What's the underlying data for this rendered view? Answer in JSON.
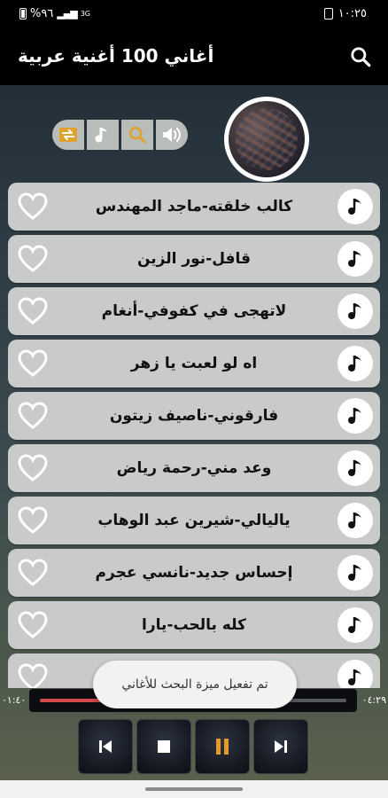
{
  "status_bar": {
    "time": "١٠:٢٥",
    "battery": "%٩٦",
    "network": "3G"
  },
  "app_bar": {
    "title": "أغاني 100 أغنية عربية",
    "search_icon": "search-icon"
  },
  "controls": [
    "repeat-icon",
    "music-note-icon",
    "search-icon",
    "volume-icon"
  ],
  "songs": [
    {
      "title": "كالب خلقته-ماجد المهندس"
    },
    {
      "title": "قافل-نور الزين"
    },
    {
      "title": "لاتهجى في كفوفي-أنغام"
    },
    {
      "title": "اه لو لعبت يا زهر"
    },
    {
      "title": "فارقوني-ناصيف زيتون"
    },
    {
      "title": "وعد مني-رحمة رياض"
    },
    {
      "title": "ياليالي-شيرين عبد الوهاب"
    },
    {
      "title": "إحساس جديد-نانسي عجرم"
    },
    {
      "title": "كله بالحب-يارا"
    },
    {
      "title": ""
    }
  ],
  "player": {
    "elapsed": "٠١:٤٠",
    "duration": "٠٤:٢٩",
    "progress": 0.37,
    "accent_color": "#d04a4a"
  },
  "toast": {
    "message": "تم تفعيل ميزة البحث للأغاني"
  },
  "player_controls": [
    "previous-icon",
    "stop-icon",
    "pause-icon",
    "next-icon"
  ]
}
